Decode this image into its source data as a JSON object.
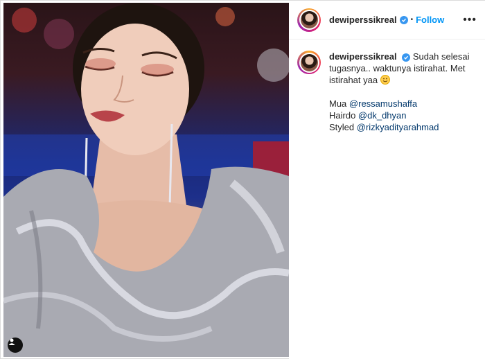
{
  "post": {
    "username": "dewiperssikreal",
    "follow_label": "Follow",
    "separator": "•",
    "more_label": "•••"
  },
  "caption": {
    "username": "dewiperssikreal",
    "text": "Sudah selesai tugasnya.. waktunya istirahat. Met istirahat yaa",
    "emoji": "smiling-face-icon",
    "credits": [
      {
        "label": "Mua",
        "mention": "@ressamushaffa"
      },
      {
        "label": "Hairdo",
        "mention": "@dk_dhyan"
      },
      {
        "label": "Styled",
        "mention": "@rizkyadityarahmad"
      }
    ]
  },
  "colors": {
    "link": "#0095f6",
    "mention": "#00376b",
    "verified": "#3897f0"
  }
}
